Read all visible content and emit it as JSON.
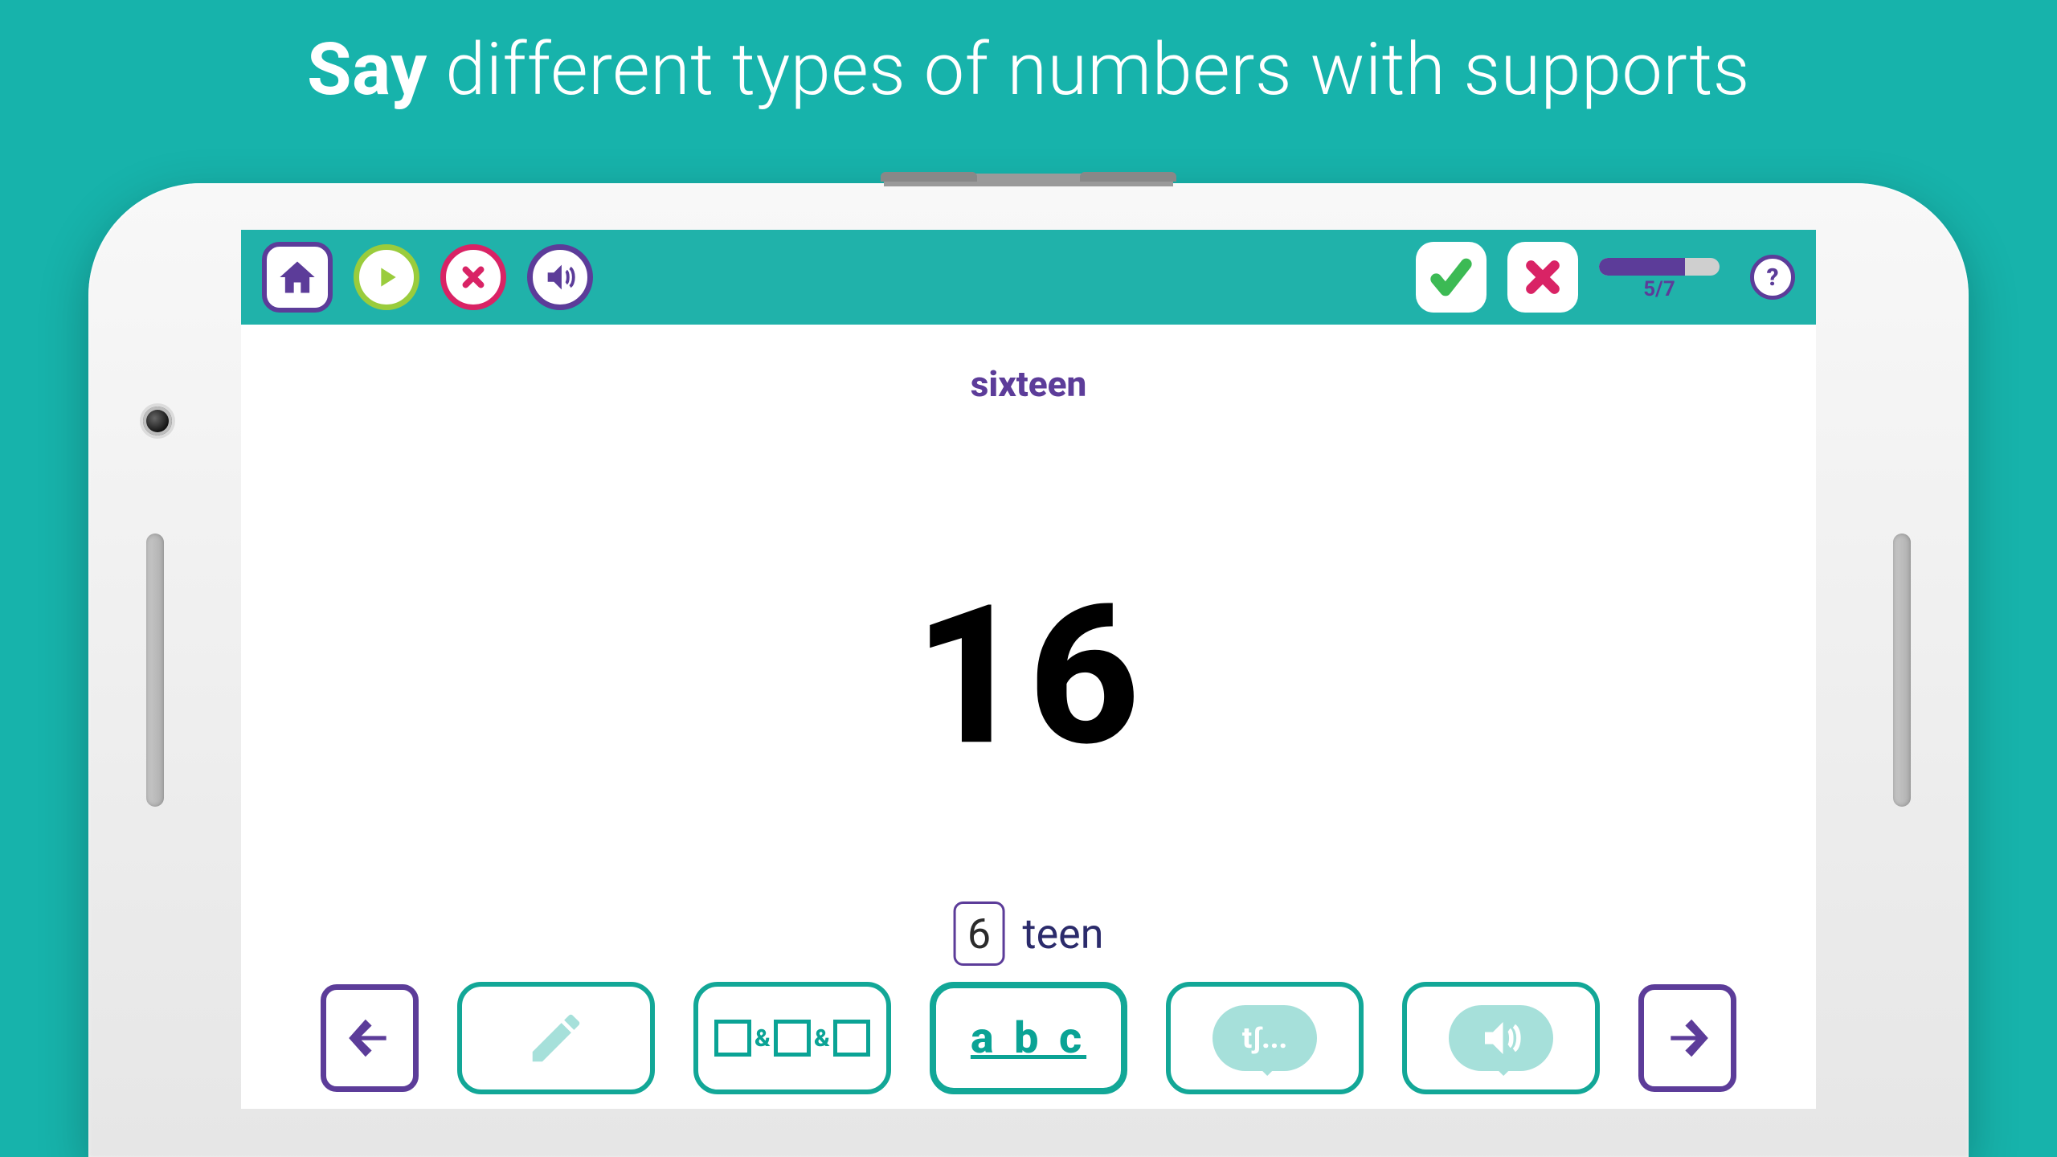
{
  "title_bold": "Say",
  "title_rest": " different types of numbers with supports",
  "topbar": {
    "progress_label": "5/7",
    "progress_percent": 71.4,
    "help_label": "?"
  },
  "content": {
    "word": "sixteen",
    "big_number": "16",
    "breakdown_digit": "6",
    "breakdown_suffix": "teen"
  },
  "bottombar": {
    "abc_label": "a b c",
    "ipa_label": "tʃ...",
    "amp": "&"
  },
  "icons": {
    "home": "home-icon",
    "play": "play-icon",
    "close": "close-icon",
    "sound": "sound-icon",
    "check": "check-icon",
    "wrong": "wrong-icon",
    "help": "help-icon",
    "arrow_left": "arrow-left-icon",
    "arrow_right": "arrow-right-icon",
    "pencil": "pencil-icon",
    "breakdown": "breakdown-icon",
    "letters": "letters-icon",
    "ipa_bubble": "ipa-bubble-icon",
    "audio_bubble": "audio-bubble-icon"
  }
}
